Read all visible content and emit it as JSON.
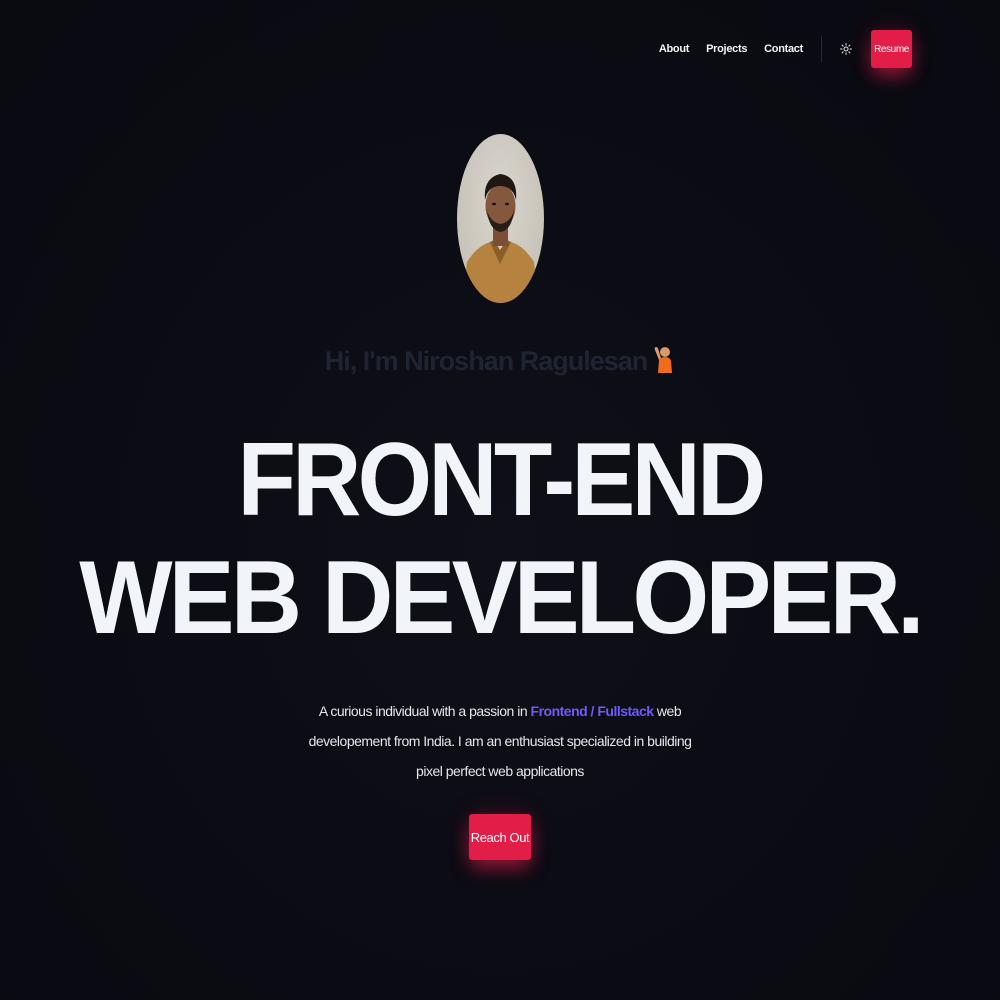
{
  "nav": {
    "links": [
      "About",
      "Projects",
      "Contact"
    ],
    "theme_icon": "sun-icon",
    "resume_label": "Resume"
  },
  "hero": {
    "greeting": "Hi, I'm Niroshan Ragulesan",
    "greeting_emoji": "waving-person-emoji",
    "headline_line1": "FRONT-END",
    "headline_line2": "WEB DEVELOPER.",
    "desc_part1": "A curious individual with a passion in ",
    "desc_highlight": "Frontend / Fullstack",
    "desc_part2": " web developement from India. I am an enthusiast specialized in building pixel perfect web applications",
    "cta_label": "Reach Out"
  },
  "colors": {
    "background": "#0b0b13",
    "accent_red": "#e11d48",
    "highlight_purple": "#6d5cf6",
    "greeting_text": "#1f2433"
  }
}
